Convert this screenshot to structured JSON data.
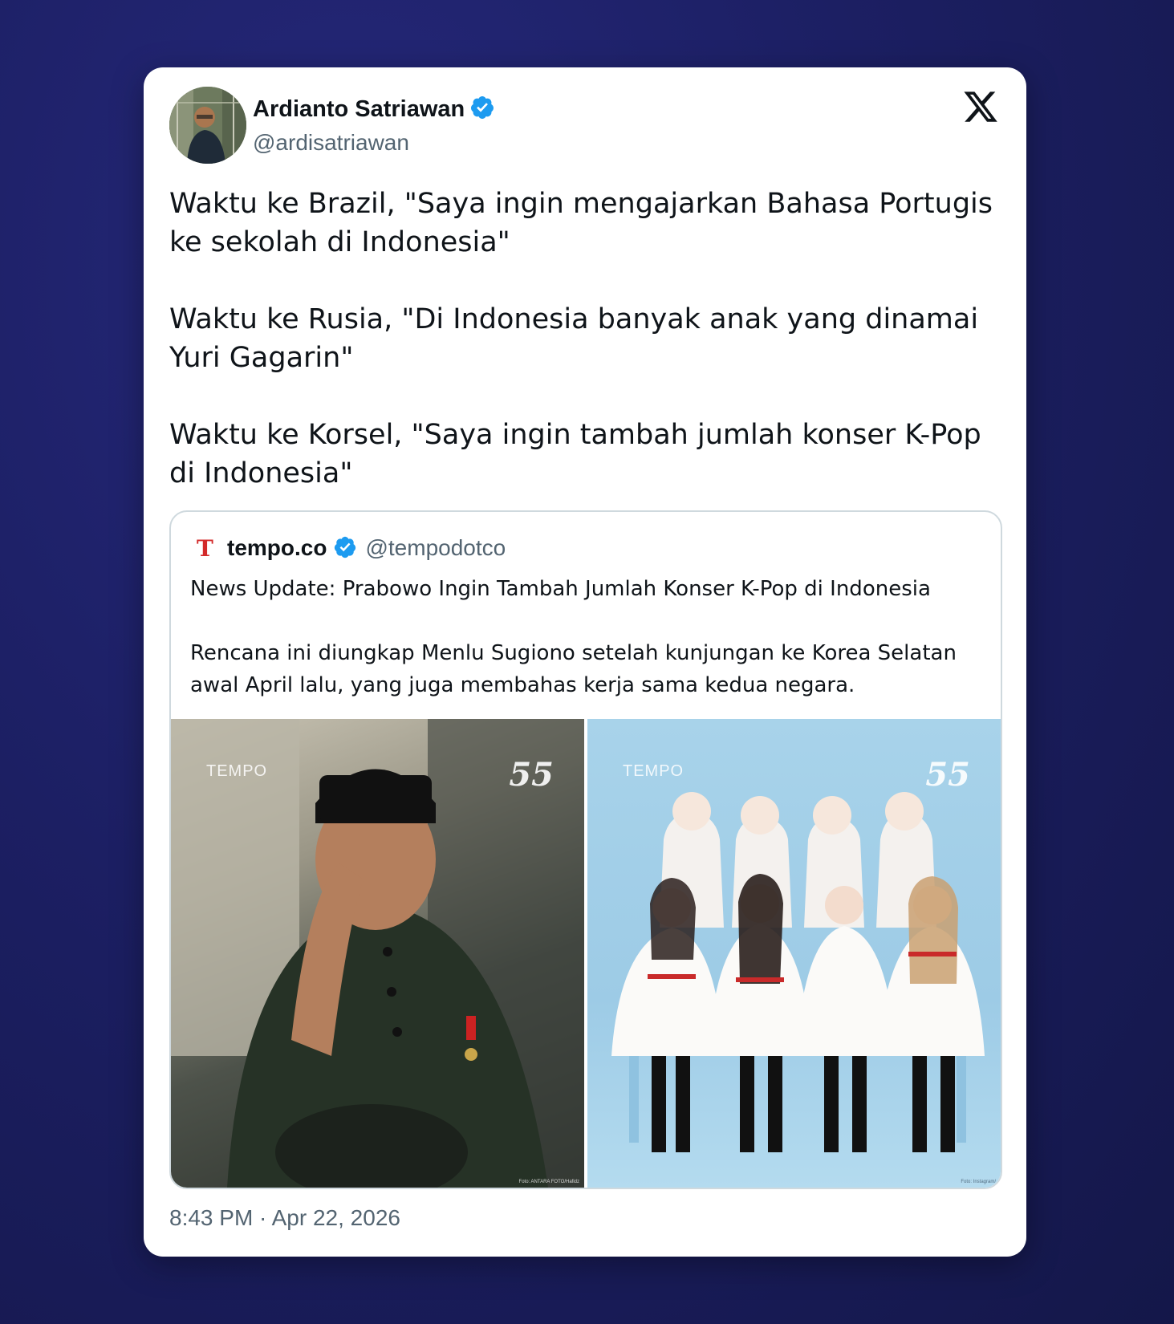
{
  "author": {
    "name": "Ardianto Satriawan",
    "handle": "@ardisatriawan",
    "verified": true,
    "avatar_icon": "profile-photo"
  },
  "platform_icon": "x-logo-icon",
  "tweet": {
    "paragraphs": [
      "Waktu ke Brazil, \"Saya ingin mengajarkan Bahasa Portugis ke sekolah di Indonesia\"",
      "Waktu ke Rusia, \"Di Indonesia banyak anak yang dinamai Yuri Gagarin\"",
      "Waktu ke Korsel, \"Saya ingin tambah jumlah konser K-Pop di Indonesia\""
    ]
  },
  "quote": {
    "logo_letter": "T",
    "name": "tempo.co",
    "handle": "@tempodotco",
    "verified": true,
    "paragraphs": [
      "News Update: Prabowo Ingin Tambah Jumlah Konser K-Pop di Indonesia",
      "Rencana ini diungkap Menlu Sugiono setelah kunjungan ke Korea Selatan awal April lalu, yang juga membahas kerja sama kedua negara."
    ],
    "images": [
      {
        "watermark": "TEMPO",
        "badge": "55",
        "credit": "Foto: ANTARA FOTO/Hafidz"
      },
      {
        "watermark": "TEMPO",
        "badge": "55",
        "credit": "Foto: Instagram/"
      }
    ]
  },
  "timestamp": "8:43 PM · Apr 22, 2026",
  "colors": {
    "background": "#1c1f63",
    "card": "#ffffff",
    "verified_blue": "#1d9bf0",
    "text_primary": "#0f1419",
    "text_secondary": "#536471",
    "tempo_red": "#d32a2a"
  }
}
